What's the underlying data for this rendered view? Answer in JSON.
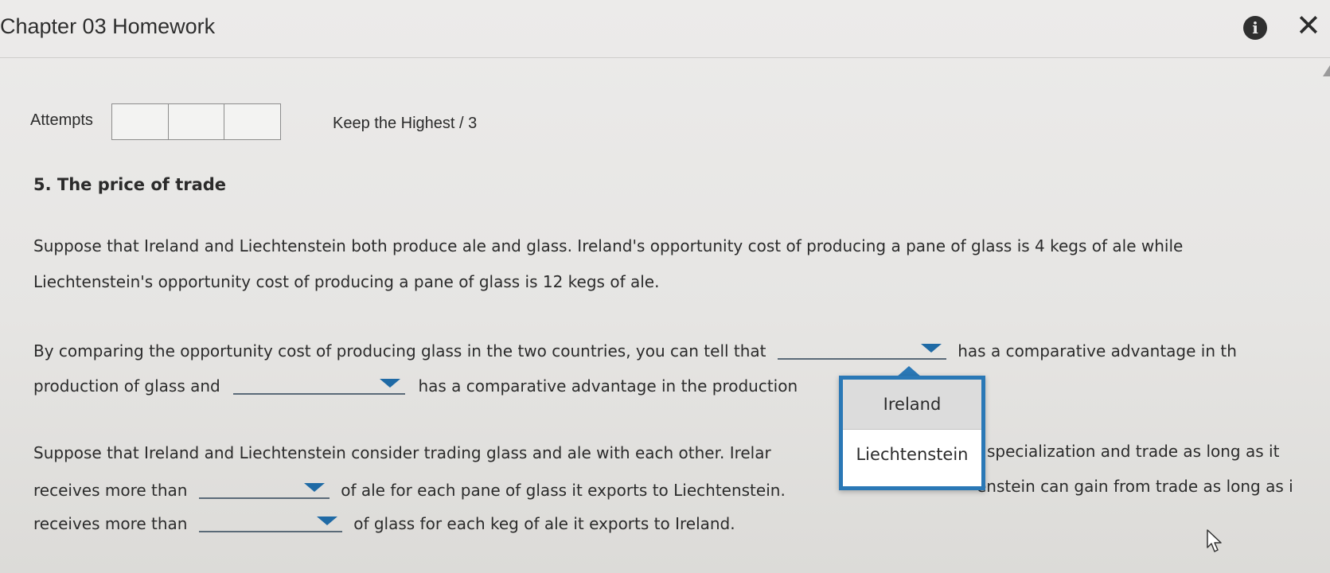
{
  "header": {
    "title": "Chapter 03 Homework",
    "info_glyph": "i",
    "close_glyph": "✕"
  },
  "attempts": {
    "label": "Attempts",
    "box_count": 3,
    "keep_label": "Keep the Highest / 3"
  },
  "question": {
    "title": "5. The price of trade",
    "p1_line1": "Suppose that Ireland and Liechtenstein both produce ale and glass. Ireland's opportunity cost of producing a pane of glass is 4 kegs of ale while",
    "p1_line2": "Liechtenstein's opportunity cost of producing a pane of glass is 12 kegs of ale.",
    "p2_line1_a": "By comparing the opportunity cost of producing glass in the two countries, you can tell that",
    "p2_line1_b": "has a comparative advantage in th",
    "p2_line2_a": "production of glass and",
    "p2_line2_b": "has a comparative advantage in the production",
    "p3_line1_a": "Suppose that Ireland and Liechtenstein consider trading glass and ale with each other. Irelar",
    "p3_line1_b": "specialization and trade as long as it",
    "p3_line2_a": "receives more than",
    "p3_line2_b": "of ale for each pane of glass it exports to Liechtenstein.",
    "p3_line2_c": "enstein can gain from trade as long as i",
    "p3_line3_a": "receives more than",
    "p3_line3_b": "of glass for each keg of ale it exports to Ireland."
  },
  "dropdown_popup": {
    "options": [
      "Ireland",
      "Liechtenstein"
    ],
    "highlighted": "Ireland"
  },
  "colors": {
    "accent": "#2a78b6",
    "caret": "#1f6aa5"
  }
}
